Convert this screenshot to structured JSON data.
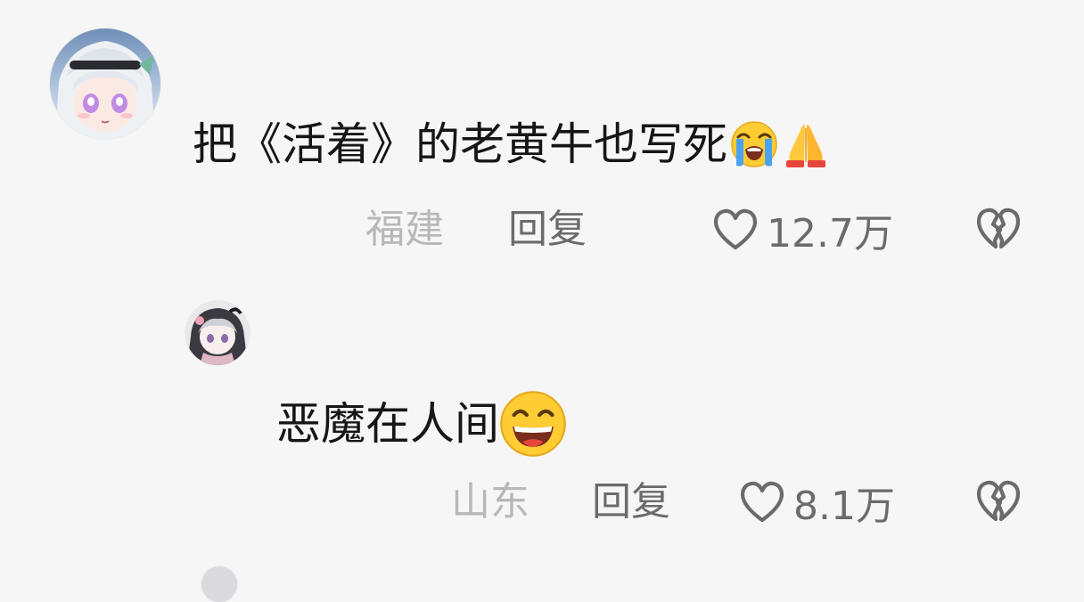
{
  "comments": [
    {
      "text": "把《活着》的老黄牛也写死",
      "emojis": [
        "loudly-crying-face",
        "folded-hands"
      ],
      "region": "福建",
      "reply_label": "回复",
      "likes": "12.7万",
      "avatar_icon": "anime-girl-avatar"
    },
    {
      "text": "恶魔在人间",
      "emojis": [
        "grinning-squinting-face"
      ],
      "region": "山东",
      "reply_label": "回复",
      "likes": "8.1万",
      "avatar_icon": "anime-girl-avatar-small"
    }
  ],
  "colors": {
    "background": "#f6f6f6",
    "text_primary": "#161616",
    "text_secondary": "#6b6b6b",
    "text_region": "#b8b8b8"
  }
}
